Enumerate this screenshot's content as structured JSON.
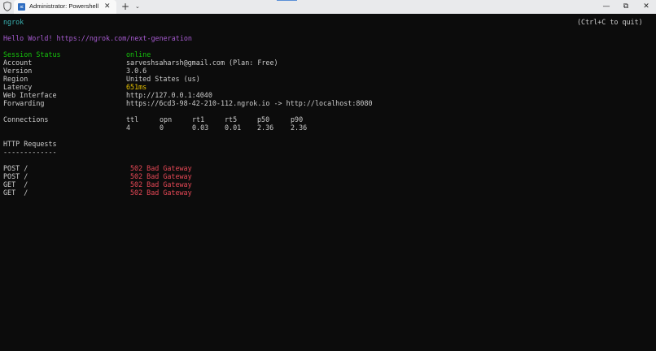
{
  "window": {
    "tab_title": "Administrator: Powershell",
    "tab_icon_glyph": "≤",
    "close_tab_glyph": "✕",
    "new_tab_glyph": "+",
    "dropdown_glyph": "⌄",
    "minimize_glyph": "—",
    "maximize_glyph": "⧉",
    "close_glyph": "✕"
  },
  "terminal": {
    "app_name": "ngrok",
    "quit_hint": "(Ctrl+C to quit)",
    "greeting": "Hello World! https://ngrok.com/next-generation",
    "status": [
      {
        "label": "Session Status",
        "value": "online"
      },
      {
        "label": "Account",
        "value": "sarveshsaharsh@gmail.com (Plan: Free)"
      },
      {
        "label": "Version",
        "value": "3.0.6"
      },
      {
        "label": "Region",
        "value": "United States (us)"
      },
      {
        "label": "Latency",
        "value": "651ms"
      },
      {
        "label": "Web Interface",
        "value": "http://127.0.0.1:4040"
      },
      {
        "label": "Forwarding",
        "value": "https://6cd3-98-42-210-112.ngrok.io -> http://localhost:8080"
      }
    ],
    "connections": {
      "label": "Connections",
      "headers": [
        "ttl",
        "opn",
        "rt1",
        "rt5",
        "p50",
        "p90"
      ],
      "values": [
        "4",
        "0",
        "0.03",
        "0.01",
        "2.36",
        "2.36"
      ]
    },
    "http_requests": {
      "title": "HTTP Requests",
      "underline": "-------------",
      "rows": [
        {
          "method": "POST /",
          "status": "502 Bad Gateway"
        },
        {
          "method": "POST /",
          "status": "502 Bad Gateway"
        },
        {
          "method": "GET  /",
          "status": "502 Bad Gateway"
        },
        {
          "method": "GET  /",
          "status": "502 Bad Gateway"
        }
      ]
    }
  },
  "colors": {
    "background": "#0c0c0c",
    "text": "#cccccc",
    "cyan": "#3ab4b4",
    "magenta": "#a75bd1",
    "green": "#16c60c",
    "yellow": "#e5c000",
    "red": "#e74856"
  }
}
